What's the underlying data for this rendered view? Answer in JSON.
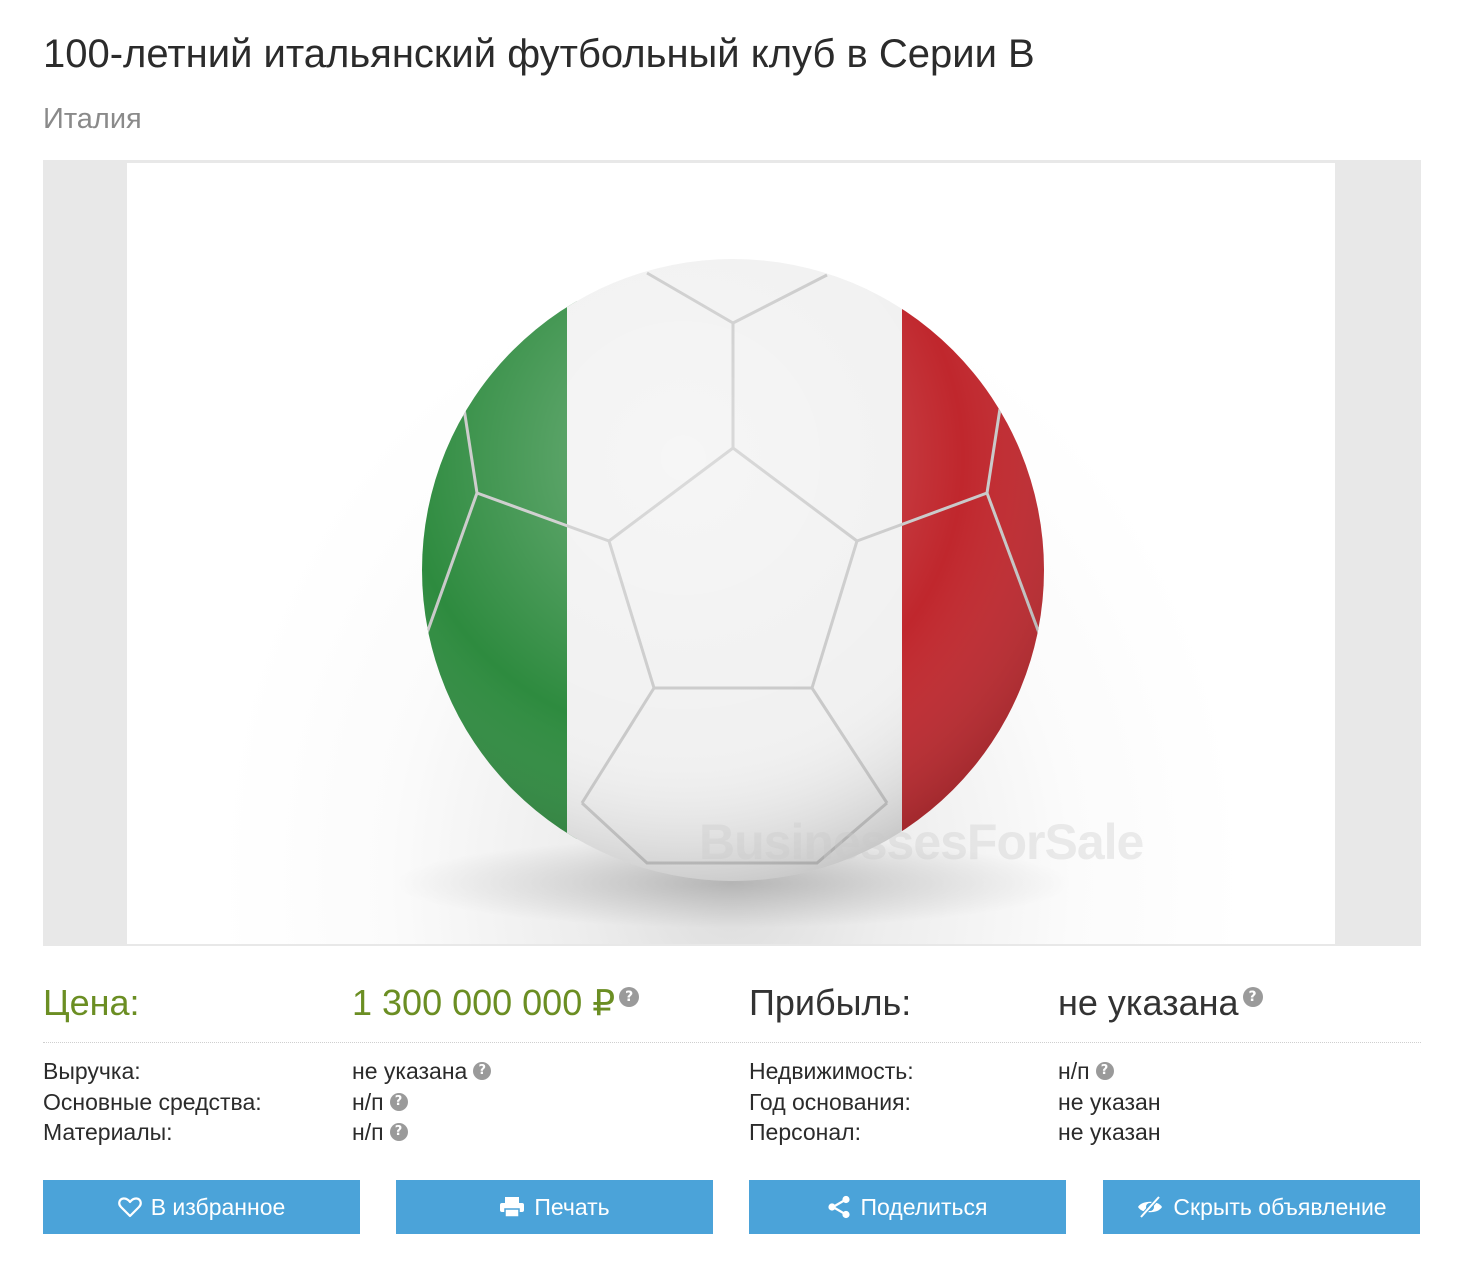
{
  "listing": {
    "title": "100-летний итальянский футбольный клуб в Серии B",
    "location": "Италия",
    "photo_watermark": "BusinessesForSale"
  },
  "stats": {
    "price_label": "Цена:",
    "price_value": "1 300 000 000 ₽",
    "profit_label": "Прибыль:",
    "profit_value": "не указана",
    "rows": [
      {
        "label": "Выручка:",
        "value": "не указана"
      },
      {
        "label": "Основные средства:",
        "value": "н/п"
      },
      {
        "label": "Материалы:",
        "value": "н/п"
      },
      {
        "label": "Недвижимость:",
        "value": "н/п"
      },
      {
        "label": "Год основания:",
        "value": "не указан"
      },
      {
        "label": "Персонал:",
        "value": "не указан"
      }
    ],
    "help_glyph": "?"
  },
  "actions": {
    "favorite": "В избранное",
    "print": "Печать",
    "share": "Поделиться",
    "hide": "Скрыть объявление"
  },
  "colors": {
    "accent_green": "#6b8e23",
    "button_blue": "#4ba3d9",
    "flag_green": "#2e8b3f",
    "flag_red": "#c0272d"
  },
  "icons": [
    "heart-icon",
    "printer-icon",
    "share-icon",
    "eye-slash-icon",
    "question-icon"
  ]
}
